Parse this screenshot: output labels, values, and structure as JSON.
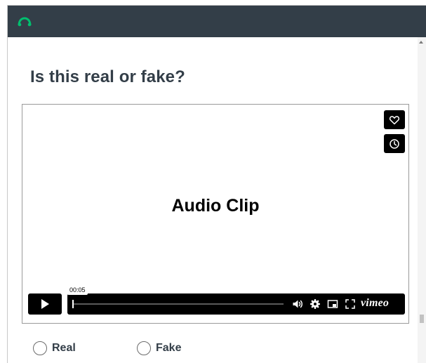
{
  "survey": {
    "question": "Is this real or fake?",
    "options": [
      {
        "label": "Real",
        "selected": false
      },
      {
        "label": "Fake",
        "selected": false
      }
    ]
  },
  "video": {
    "title_text": "Audio Clip",
    "current_time": "00:05",
    "brand": "vimeo",
    "progress_fraction": 0.0
  },
  "colors": {
    "topbar": "#333e48",
    "logo": "#00bf6f",
    "question_text": "#333e48",
    "player_controls": "#000000"
  },
  "icons": {
    "logo": "surveymonkey-logo-icon",
    "like": "heart-icon",
    "watch_later": "clock-icon",
    "play": "play-icon",
    "volume": "volume-icon",
    "settings": "gear-icon",
    "pip": "picture-in-picture-icon",
    "fullscreen": "fullscreen-icon"
  }
}
